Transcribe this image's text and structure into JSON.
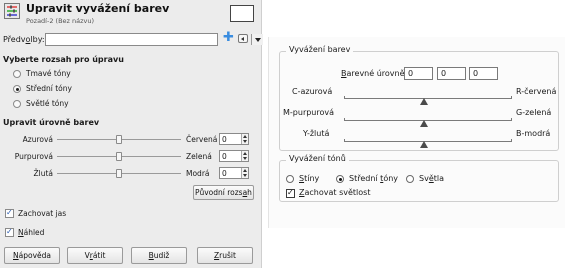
{
  "gimp": {
    "title": "Upravit vyvážení barev",
    "subtitle": "Pozadí-2 (Bez názvu)",
    "presets_label_pre": "Předv",
    "presets_label_u": "o",
    "presets_label_post": "lby:",
    "preset_value": "",
    "range_title": "Vyberte rozsah pro úpravu",
    "ranges": [
      {
        "label": "Tmavé tóny",
        "selected": false
      },
      {
        "label": "Střední tóny",
        "selected": true
      },
      {
        "label": "Světlé tóny",
        "selected": false
      }
    ],
    "levels_title": "Upravit úrovně barev",
    "sliders": [
      {
        "left": "Azurová",
        "right": "Červená",
        "value": "0"
      },
      {
        "left": "Purpurová",
        "right": "Zelená",
        "value": "0"
      },
      {
        "left": "Žlutá",
        "right": "Modrá",
        "value": "0"
      }
    ],
    "reset_pre": "Původní rozs",
    "reset_u": "a",
    "reset_post": "h",
    "preserve_label": "Zachovat jas",
    "preserve_checked": true,
    "preview_u": "N",
    "preview_post": "áhled",
    "preview_checked": true,
    "buttons": {
      "help_u": "N",
      "help_post": "ápověda",
      "reset_pre": "V",
      "reset_u": "r",
      "reset_post": "átit",
      "ok_u": "B",
      "ok_post": "udiž",
      "cancel_u": "Z",
      "cancel_post": "rušit"
    }
  },
  "win": {
    "balance_title": "Vyvážení barev",
    "levels_pre": "",
    "levels_u": "B",
    "levels_post": "arevné úrovně:",
    "levels_values": [
      "0",
      "0",
      "0"
    ],
    "sliders": [
      {
        "left": "C-azurová",
        "right": "R-červená"
      },
      {
        "left": "M-purpurová",
        "right": "G-zelená"
      },
      {
        "left": "Y-žlutá",
        "right": "B-modrá"
      }
    ],
    "tone_title": "Vyvážení tónů",
    "tones": [
      {
        "pre": "",
        "u": "S",
        "post": "tíny",
        "selected": false
      },
      {
        "pre": "Střední ",
        "u": "t",
        "post": "óny",
        "selected": true
      },
      {
        "pre": "Sv",
        "u": "ě",
        "post": "tla",
        "selected": false
      }
    ],
    "preserve_u": "Z",
    "preserve_post": "achovat světlost",
    "preserve_checked": true
  }
}
